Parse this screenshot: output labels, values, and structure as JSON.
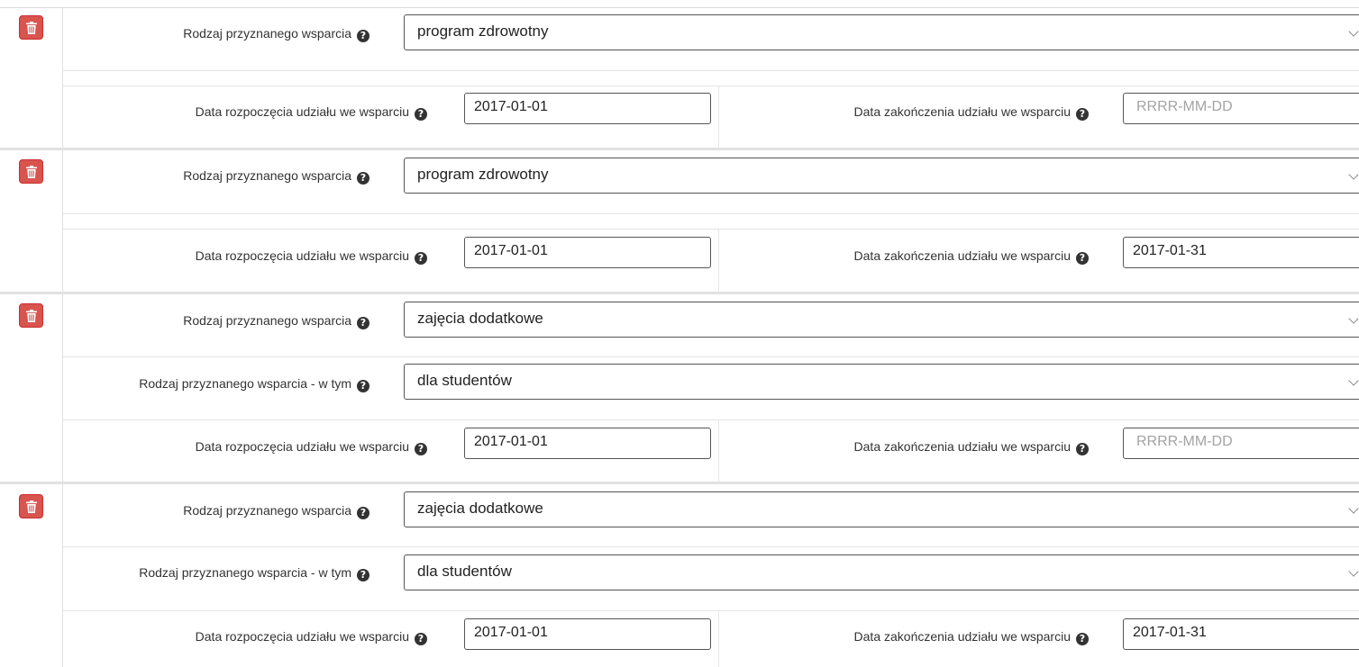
{
  "help_glyph": "?",
  "entries": [
    {
      "support_type_label": "Rodzaj przyznanego wsparcia",
      "support_type_value": "program zdrowotny",
      "start_label": "Data rozpoczęcia udziału we wsparciu",
      "start_value": "2017-01-01",
      "end_label": "Data zakończenia udziału we wsparciu",
      "end_value": "",
      "end_placeholder": "RRRR-MM-DD"
    },
    {
      "support_type_label": "Rodzaj przyznanego wsparcia",
      "support_type_value": "program zdrowotny",
      "start_label": "Data rozpoczęcia udziału we wsparciu",
      "start_value": "2017-01-01",
      "end_label": "Data zakończenia udziału we wsparciu",
      "end_value": "2017-01-31",
      "end_placeholder": ""
    },
    {
      "support_type_label": "Rodzaj przyznanego wsparcia",
      "support_type_value": "zajęcia dodatkowe",
      "subtype_label": "Rodzaj przyznanego wsparcia - w tym",
      "subtype_value": "dla studentów",
      "start_label": "Data rozpoczęcia udziału we wsparciu",
      "start_value": "2017-01-01",
      "end_label": "Data zakończenia udziału we wsparciu",
      "end_value": "",
      "end_placeholder": "RRRR-MM-DD"
    },
    {
      "support_type_label": "Rodzaj przyznanego wsparcia",
      "support_type_value": "zajęcia dodatkowe",
      "subtype_label": "Rodzaj przyznanego wsparcia - w tym",
      "subtype_value": "dla studentów",
      "start_label": "Data rozpoczęcia udziału we wsparciu",
      "start_value": "2017-01-01",
      "end_label": "Data zakończenia udziału we wsparciu",
      "end_value": "2017-01-31",
      "end_placeholder": ""
    }
  ]
}
